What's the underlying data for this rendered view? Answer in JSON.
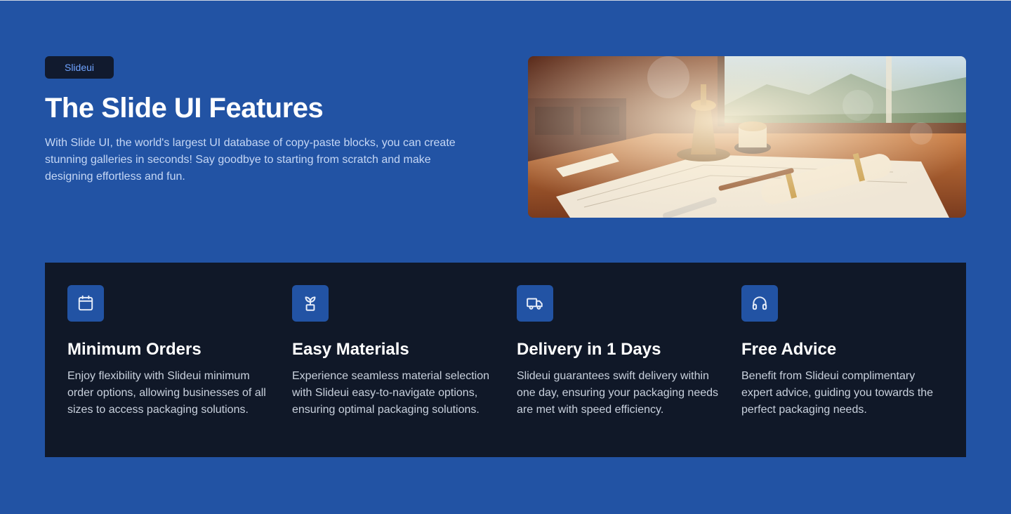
{
  "hero": {
    "badge": "Slideui",
    "title": "The Slide UI Features",
    "description": "With Slide UI, the world's largest UI database of copy-paste blocks, you can create stunning galleries in seconds! Say goodbye to starting from scratch and make designing effortless and fun."
  },
  "features": [
    {
      "icon": "calendar-icon",
      "title": "Minimum Orders",
      "text": "Enjoy flexibility with Slideui minimum order options, allowing businesses of all sizes to access packaging solutions."
    },
    {
      "icon": "sprout-icon",
      "title": "Easy Materials",
      "text": "Experience seamless material selection with Slideui easy-to-navigate options, ensuring optimal packaging solutions."
    },
    {
      "icon": "truck-icon",
      "title": "Delivery in 1 Days",
      "text": "Slideui guarantees swift delivery within one day, ensuring your packaging needs are met with speed efficiency."
    },
    {
      "icon": "headphones-icon",
      "title": "Free Advice",
      "text": "Benefit from Slideui complimentary expert advice, guiding you towards the perfect packaging needs."
    }
  ],
  "colors": {
    "background": "#2253a4",
    "panel": "#101828",
    "badge_background": "#111a2e",
    "badge_text": "#6fa3ff",
    "icon_box": "#2253a4"
  }
}
